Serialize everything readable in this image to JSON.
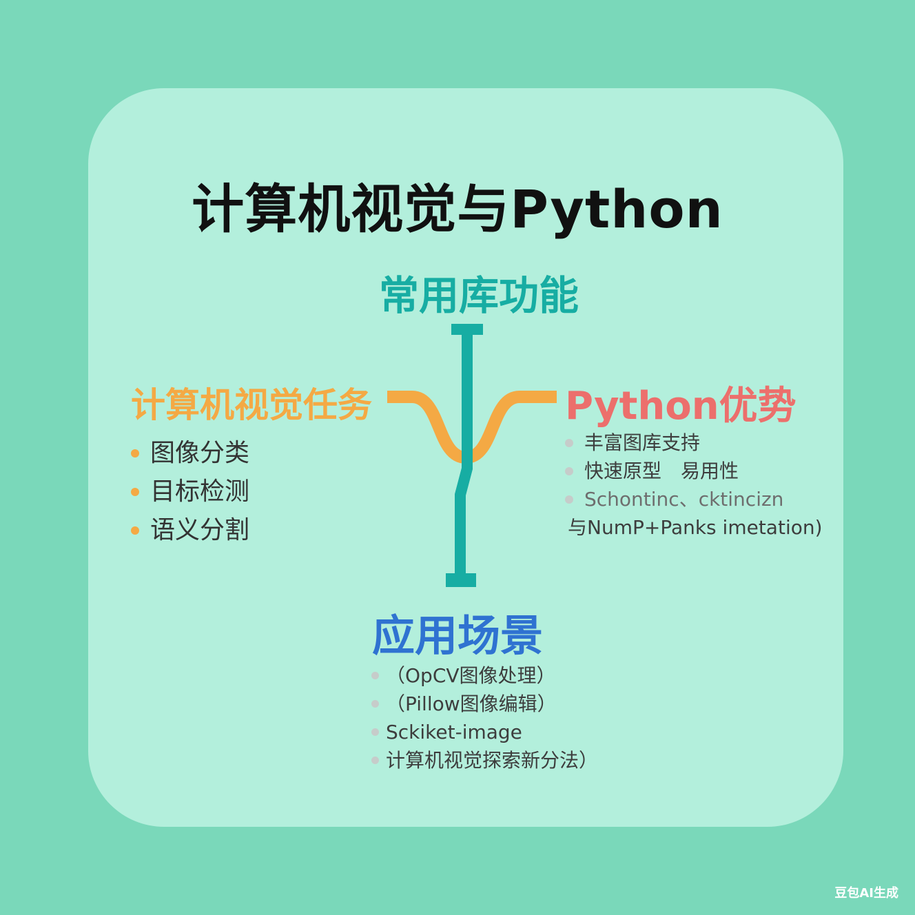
{
  "title": "计算机视觉与Python",
  "colors": {
    "background": "#7ad8ba",
    "card": "#b3efdc",
    "teal": "#17ada3",
    "orange": "#f4a944",
    "coral": "#ec6f6c",
    "blue": "#2f72d1",
    "bullet_grey": "#c6ccca"
  },
  "library_functions": {
    "heading": "常用库功能"
  },
  "cv_tasks": {
    "heading": "计算机视觉任务",
    "items": [
      "图像分类",
      "目标检测",
      "语义分割"
    ]
  },
  "python_advantages": {
    "heading": "Python优势",
    "items": [
      "丰富图库支持",
      "快速原型　易用性",
      "Schontinc、cktincizn",
      "与NumP+Panks imetation)"
    ]
  },
  "application_scenarios": {
    "heading": "应用场景",
    "items": [
      "（OpCV图像处理）",
      "（Pillow图像编辑）",
      "Sckiket-image",
      "计算机视觉探索新分法）"
    ]
  },
  "watermark": "豆包AI生成"
}
